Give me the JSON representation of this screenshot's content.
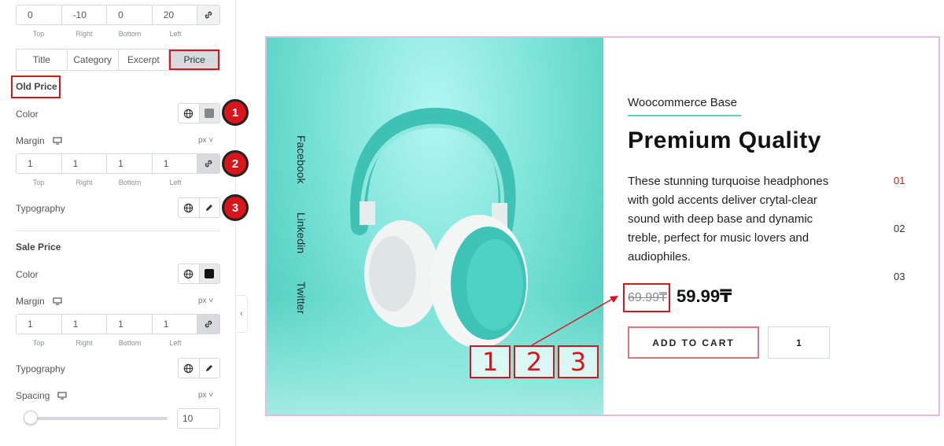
{
  "panel": {
    "padding_top": {
      "values": [
        "0",
        "-10",
        "0",
        "20"
      ],
      "labels": [
        "Top",
        "Right",
        "Bottom",
        "Left"
      ]
    },
    "tabs": [
      {
        "label": "Title"
      },
      {
        "label": "Category"
      },
      {
        "label": "Excerpt"
      },
      {
        "label": "Price",
        "active": true
      }
    ],
    "old_price": {
      "title": "Old Price",
      "color_label": "Color",
      "color_value": "#888888",
      "margin_label": "Margin",
      "margin_unit": "px",
      "margin_values": [
        "1",
        "1",
        "1",
        "1"
      ],
      "margin_labels": [
        "Top",
        "Right",
        "Bottom",
        "Left"
      ],
      "typography_label": "Typography"
    },
    "sale_price": {
      "title": "Sale Price",
      "color_label": "Color",
      "color_value": "#111111",
      "margin_label": "Margin",
      "margin_unit": "px",
      "margin_values": [
        "1",
        "1",
        "1",
        "1"
      ],
      "margin_labels": [
        "Top",
        "Right",
        "Bottom",
        "Left"
      ],
      "typography_label": "Typography",
      "spacing_label": "Spacing",
      "spacing_unit": "px",
      "spacing_value": "10"
    },
    "badges": [
      "1",
      "2",
      "3"
    ],
    "accent_red": "#d8141c"
  },
  "preview": {
    "social": [
      "Facebook",
      "Linkedin",
      "Twitter"
    ],
    "subtitle": "Woocommerce Base",
    "headline": "Premium Quality",
    "description": "These stunning turquoise headphones with gold accents deliver crytal-clear sound with deep base and dynamic treble, perfect for music lovers and audiophiles.",
    "old_price": "69.99₸",
    "sale_price": "59.99₸",
    "add_to_cart": "ADD TO CART",
    "quantity": "1",
    "pager": [
      "01",
      "02",
      "03"
    ],
    "annotation_numbers": [
      "1",
      "2",
      "3"
    ],
    "accent_teal": "#5fd0c2"
  }
}
